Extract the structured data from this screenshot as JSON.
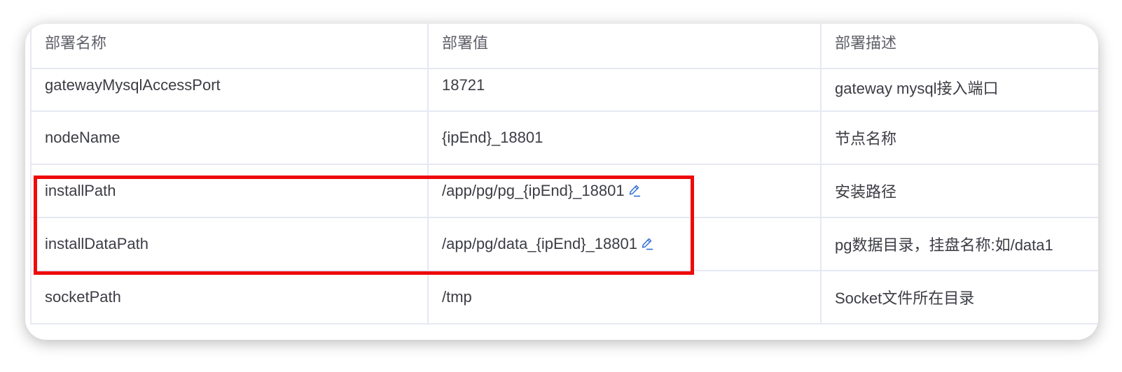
{
  "table": {
    "headers": [
      "部署名称",
      "部署值",
      "部署描述"
    ],
    "rows": [
      {
        "name": "gatewayMysqlAccessPort",
        "value": "18721",
        "description": "gateway mysql接入端口",
        "editable": false
      },
      {
        "name": "nodeName",
        "value": "{ipEnd}_18801",
        "description": "节点名称",
        "editable": false
      },
      {
        "name": "installPath",
        "value": "/app/pg/pg_{ipEnd}_18801",
        "description": "安装路径",
        "editable": true
      },
      {
        "name": "installDataPath",
        "value": "/app/pg/data_{ipEnd}_18801",
        "description": "pg数据目录，挂盘名称:如/data1",
        "editable": true
      },
      {
        "name": "socketPath",
        "value": "/tmp",
        "description": "Socket文件所在目录",
        "editable": false
      }
    ]
  },
  "icons": {
    "edit": "edit-pencil-icon"
  },
  "colors": {
    "highlight_border": "#ee0a0a",
    "edit_icon": "#2f6fd6",
    "grid_line": "#e6e8f3",
    "header_text": "#5f6068",
    "cell_text": "#3c3d44"
  }
}
